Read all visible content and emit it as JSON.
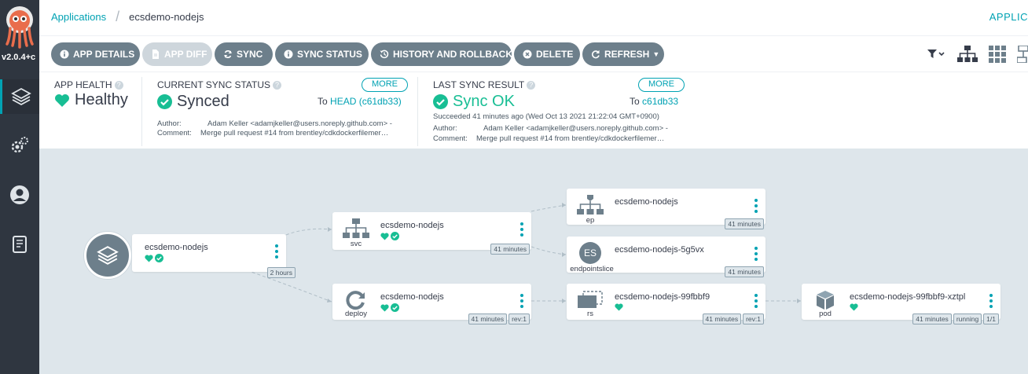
{
  "sidebar": {
    "version": "v2.0.4+c",
    "items": [
      "applications-icon",
      "settings-icon",
      "user-icon",
      "docs-icon"
    ]
  },
  "topbar": {
    "breadcrumb_root": "Applications",
    "breadcrumb_current": "ecsdemo-nodejs",
    "right_label": "APPLIC"
  },
  "toolbar": {
    "app_details": "APP DETAILS",
    "app_diff": "APP DIFF",
    "sync": "SYNC",
    "sync_status": "SYNC STATUS",
    "history": "HISTORY AND ROLLBACK",
    "delete": "DELETE",
    "refresh": "REFRESH"
  },
  "status": {
    "app_health_label": "APP HEALTH",
    "app_health_value": "Healthy",
    "sync_status_label": "CURRENT SYNC STATUS",
    "sync_status_value": "Synced",
    "sync_more": "MORE",
    "sync_to_prefix": "To",
    "sync_to_rev": "HEAD (c61db33)",
    "sync_author_key": "Author:",
    "sync_author": "Adam Keller <adamjkeller@users.noreply.github.com> -",
    "sync_comment_key": "Comment:",
    "sync_comment": "Merge pull request #14 from brentley/cdkdockerfilemer…",
    "last_sync_label": "LAST SYNC RESULT",
    "last_sync_value": "Sync OK",
    "last_more": "MORE",
    "last_to_prefix": "To",
    "last_to_rev": "c61db33",
    "last_succeeded": "Succeeded 41 minutes ago (Wed Oct 13 2021 21:22:04 GMT+0900)",
    "last_author_key": "Author:",
    "last_author": "Adam Keller <adamjkeller@users.noreply.github.com> -",
    "last_comment_key": "Comment:",
    "last_comment": "Merge pull request #14 from brentley/cdkdockerfilemer…"
  },
  "graph": {
    "app": {
      "name": "ecsdemo-nodejs",
      "tags": [
        "2 hours"
      ]
    },
    "svc": {
      "kind": "svc",
      "name": "ecsdemo-nodejs",
      "tags": [
        "41 minutes"
      ]
    },
    "deploy": {
      "kind": "deploy",
      "name": "ecsdemo-nodejs",
      "tags": [
        "41 minutes",
        "rev:1"
      ]
    },
    "ep": {
      "kind": "ep",
      "name": "ecsdemo-nodejs",
      "tags": [
        "41 minutes"
      ]
    },
    "es": {
      "kind": "endpointslice",
      "badge": "ES",
      "name": "ecsdemo-nodejs-5g5vx",
      "tags": [
        "41 minutes"
      ]
    },
    "rs": {
      "kind": "rs",
      "name": "ecsdemo-nodejs-99fbbf9",
      "tags": [
        "41 minutes",
        "rev:1"
      ]
    },
    "pod": {
      "kind": "pod",
      "name": "ecsdemo-nodejs-99fbbf9-xztpl",
      "tags": [
        "41 minutes",
        "running",
        "1/1"
      ]
    }
  },
  "colors": {
    "accent": "#00a2b3",
    "healthy": "#18be94",
    "sidebar": "#2f3640",
    "button": "#6d7f8b"
  }
}
